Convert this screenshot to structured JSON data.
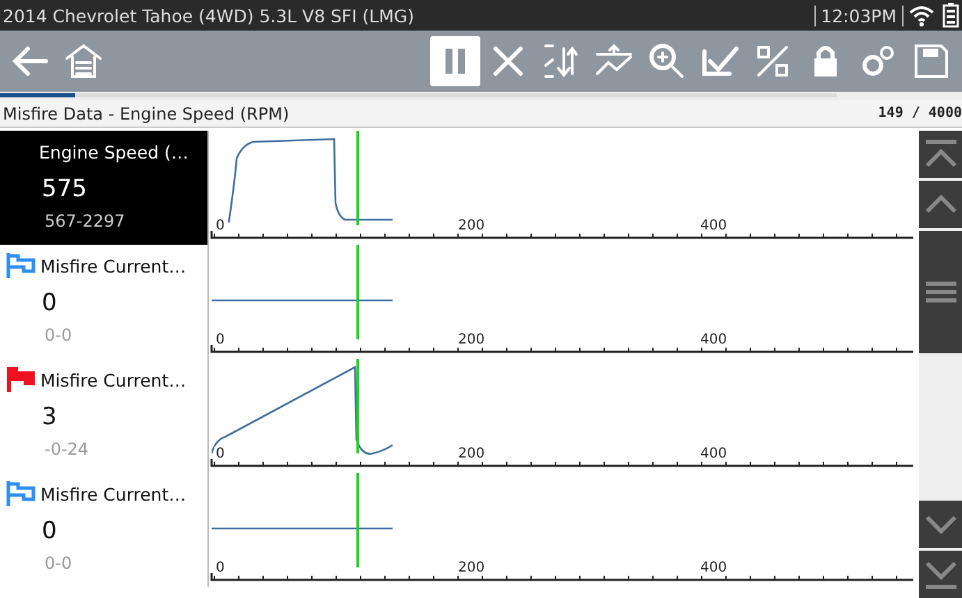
{
  "status_bar": {
    "title": "2014 Chevrolet Tahoe (4WD) 5.3L V8 SFI (LMG)",
    "time": "12:03PM"
  },
  "toolbar": [
    {
      "kind": "back",
      "selected": false
    },
    {
      "kind": "home",
      "selected": false
    },
    {
      "kind": "pause",
      "selected": true
    },
    {
      "kind": "clear",
      "selected": false
    },
    {
      "kind": "sort",
      "selected": false
    },
    {
      "kind": "scale",
      "selected": false
    },
    {
      "kind": "zoom",
      "selected": false
    },
    {
      "kind": "check",
      "selected": false
    },
    {
      "kind": "percent",
      "selected": false
    },
    {
      "kind": "lock",
      "selected": false
    },
    {
      "kind": "settings",
      "selected": false
    },
    {
      "kind": "save",
      "selected": false
    }
  ],
  "progress": {
    "level": 0.09
  },
  "header": {
    "title": "Misfire Data - Engine Speed (RPM)",
    "counter": "149 / 4000"
  },
  "rows": [
    {
      "name": "Engine Speed (…",
      "value": "575",
      "range": "567-2297",
      "selected": true,
      "ticks": [
        "0",
        "200",
        "400"
      ]
    },
    {
      "name": "Misfire Current…",
      "value": "0",
      "range": "0-0",
      "selected": false,
      "flag": {
        "filled": false
      },
      "ticks": [
        "0",
        "200",
        "400"
      ]
    },
    {
      "name": "Misfire Current…",
      "value": "3",
      "range": "-0-24",
      "selected": false,
      "flag": {
        "filled": true
      },
      "ticks": [
        "0",
        "200",
        "400"
      ]
    },
    {
      "name": "Misfire Current…",
      "value": "0",
      "range": "0-0",
      "selected": false,
      "flag": {
        "filled": false
      },
      "ticks": [
        "0",
        "200",
        "400"
      ]
    }
  ]
}
